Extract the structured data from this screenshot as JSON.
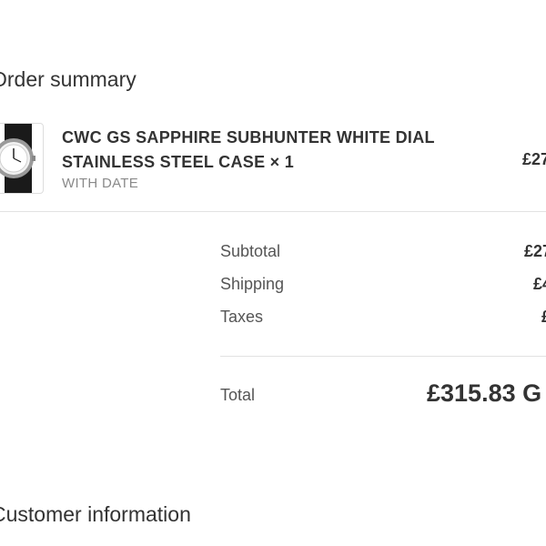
{
  "order_summary": {
    "heading": "Order summary"
  },
  "line_item": {
    "name": "CWC GS SAPPHIRE SUBHUNTER WHITE DIAL STAINLESS STEEL CASE × 1",
    "variant": "WITH DATE",
    "price": "£27",
    "thumbnail_icon": "watch-image-icon"
  },
  "totals": {
    "subtotal_label": "Subtotal",
    "subtotal_value": "£27",
    "shipping_label": "Shipping",
    "shipping_value": "£4",
    "taxes_label": "Taxes",
    "taxes_value": "£",
    "total_label": "Total",
    "total_value": "£315.83 G"
  },
  "customer_information": {
    "heading": "Customer information"
  }
}
